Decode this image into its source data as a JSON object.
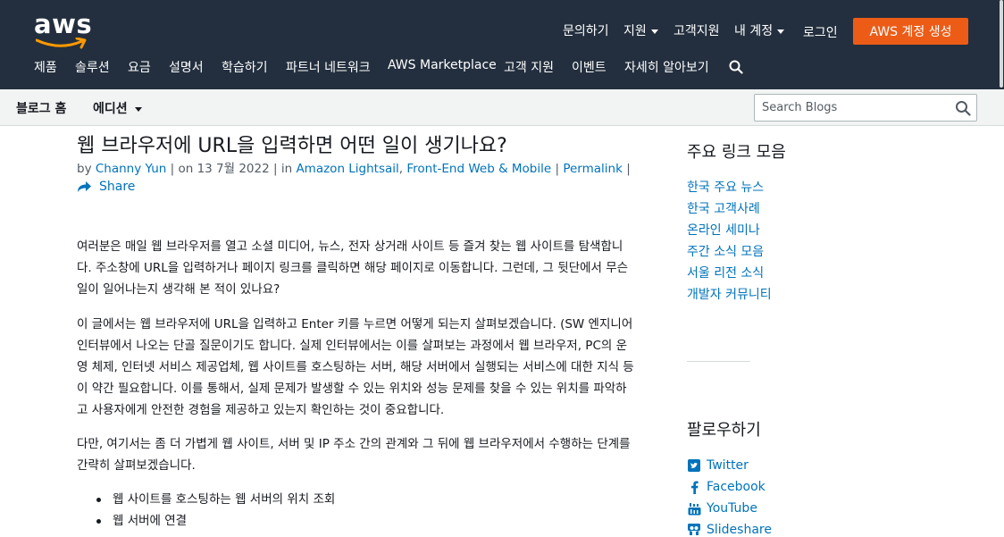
{
  "header": {
    "logo_text": "aws",
    "util_nav": [
      "문의하기",
      "지원",
      "고객지원",
      "내 계정",
      "로그인"
    ],
    "cta_label": "AWS 계정 생성",
    "main_nav": [
      "제품",
      "솔루션",
      "요금",
      "설명서",
      "학습하기",
      "파트너 네트워크",
      "AWS Marketplace",
      "고객 지원",
      "이벤트",
      "자세히 알아보기"
    ],
    "colors": {
      "bar": "#232f3e",
      "cta": "#ec5c17",
      "link": "#0073bb"
    }
  },
  "subnav": {
    "home_label": "블로그 홈",
    "edition_label": "에디션",
    "search_placeholder": "Search Blogs"
  },
  "article": {
    "title": "웹 브라우저에 URL을 입력하면 어떤 일이 생기나요?",
    "by_prefix": "by",
    "author": "Channy Yun",
    "on_text": "| on 13 7월 2022 | in",
    "category_1": "Amazon Lightsail",
    "category_2": "Front-End Web & Mobile",
    "sep_1": ",",
    "sep_2": "|",
    "sep_3": "|",
    "permalink": "Permalink",
    "share": "Share",
    "paragraphs": [
      "여러분은 매일 웹 브라우저를 열고 소셜 미디어, 뉴스, 전자 상거래 사이트 등 즐겨 찾는 웹 사이트를 탐색합니다. 주소창에 URL을 입력하거나 페이지 링크를 클릭하면 해당 페이지로 이동합니다. 그런데, 그 뒷단에서 무슨 일이 일어나는지 생각해 본 적이 있나요?",
      "이 글에서는 웹 브라우저에 URL을 입력하고 Enter 키를 누르면 어떻게 되는지 살펴보겠습니다. (SW 엔지니어 인터뷰에서 나오는 단골 질문이기도 합니다. 실제 인터뷰에서는 이를 살펴보는 과정에서 웹 브라우저, PC의 운영 체제, 인터넷 서비스 제공업체, 웹 사이트를 호스팅하는 서버, 해당 서버에서 실행되는 서비스에 대한 지식 등이 약간 필요합니다. 이를 통해서, 실제 문제가 발생할 수 있는 위치와 성능 문제를 찾을 수 있는 위치를 파악하고 사용자에게 안전한 경험을 제공하고 있는지 확인하는 것이 중요합니다.",
      "다만, 여기서는 좀 더 가볍게  웹 사이트, 서버 및 IP 주소 간의 관계와 그 뒤에 웹 브라우저에서 수행하는 단계를 간략히 살펴보겠습니다."
    ],
    "bullets": [
      "웹 사이트를 호스팅하는 웹 서버의 위치 조회",
      "웹 서버에 연결"
    ]
  },
  "sidebar": {
    "links_title": "주요 링크 모음",
    "links": [
      "한국 주요 뉴스",
      "한국 고객사례",
      "온라인 세미나",
      "주간 소식 모음",
      "서울 리전 소식",
      "개발자 커뮤니티"
    ],
    "follow_title": "팔로우하기",
    "follow": [
      {
        "label": "Twitter",
        "icon": "twitter-icon"
      },
      {
        "label": "Facebook",
        "icon": "facebook-icon"
      },
      {
        "label": "YouTube",
        "icon": "youtube-icon"
      },
      {
        "label": "Slideshare",
        "icon": "slideshare-icon"
      }
    ]
  }
}
